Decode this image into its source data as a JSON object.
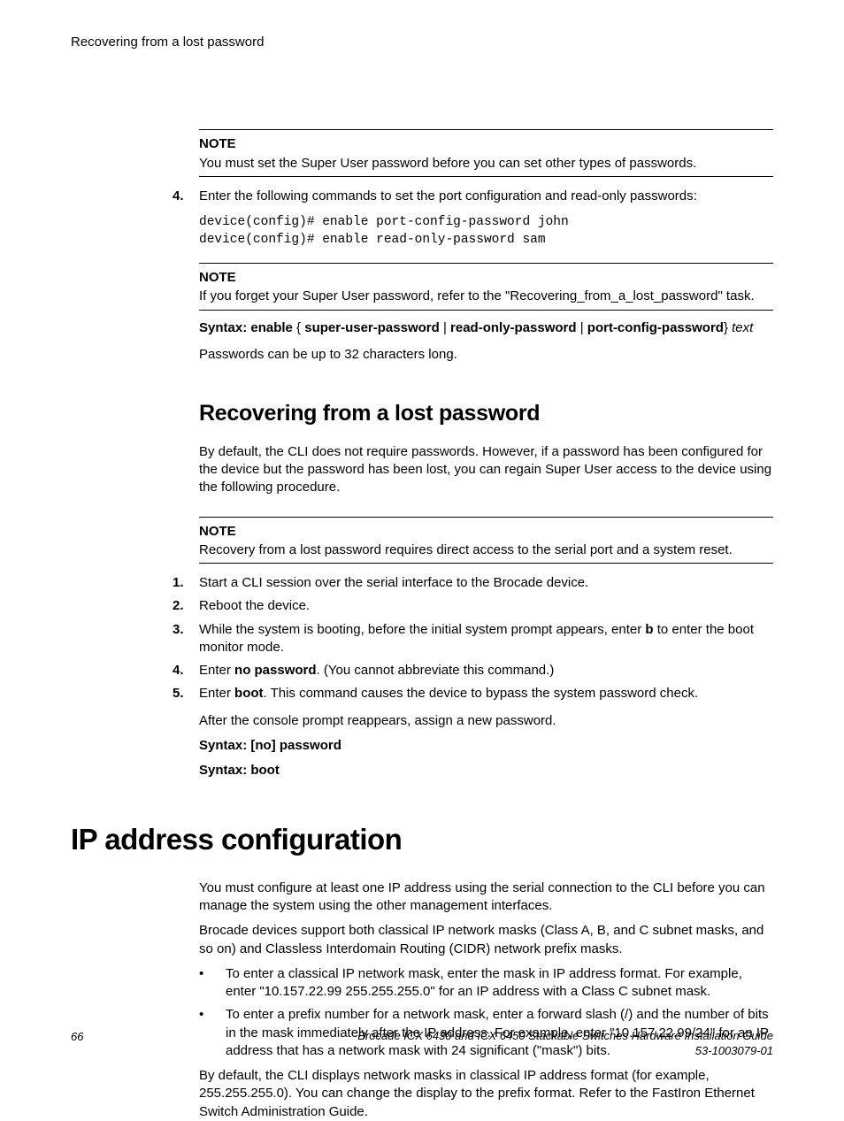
{
  "running_head": "Recovering from a lost password",
  "note1": {
    "label": "NOTE",
    "text": "You must set the Super User password before you can set other types of passwords."
  },
  "step4": {
    "num": "4.",
    "text": "Enter the following commands to set the port configuration and read-only passwords:"
  },
  "code_block": "device(config)# enable port-config-password john\ndevice(config)# enable read-only-password sam",
  "note2": {
    "label": "NOTE",
    "text": "If you forget your Super User password, refer to the \"Recovering_from_a_lost_password\" task."
  },
  "syntax_enable": {
    "prefix": "Syntax: enable",
    "brace_open": " { ",
    "opt1": "super-user-password",
    "sep": " | ",
    "opt2": "read-only-password",
    "opt3": "port-config-password",
    "brace_close": "} ",
    "tail_italic": "text"
  },
  "pw_len": "Passwords can be up to 32 characters long.",
  "h2_recover": "Recovering from a lost password",
  "recover_intro": "By default, the CLI does not require passwords. However, if a password has been configured for the device but the password has been lost, you can regain Super User access to the device using the following procedure.",
  "note3": {
    "label": "NOTE",
    "text": "Recovery from a lost password requires direct access to the serial port and a system reset."
  },
  "steps": [
    {
      "num": "1.",
      "text_before": "Start a CLI session over the serial interface to the Brocade device."
    },
    {
      "num": "2.",
      "text_before": "Reboot the device."
    },
    {
      "num": "3.",
      "text_before": "While the system is booting, before the initial system prompt appears, enter ",
      "bold": "b",
      "text_after": " to enter the boot monitor mode."
    },
    {
      "num": "4.",
      "text_before": "Enter ",
      "bold": "no password",
      "text_after": ". (You cannot abbreviate this command.)"
    },
    {
      "num": "5.",
      "text_before": "Enter ",
      "bold": "boot",
      "text_after": ". This command causes the device to bypass the system password check."
    }
  ],
  "after_steps": "After the console prompt reappears, assign a new password.",
  "syntax_no_pw": "Syntax: [no] password",
  "syntax_boot": "Syntax: boot",
  "h1_ip": "IP address configuration",
  "ip_p1": "You must configure at least one IP address using the serial connection to the CLI before you can manage the system using the other management interfaces.",
  "ip_p2": "Brocade devices support both classical IP network masks (Class A, B, and C subnet masks, and so on) and Classless Interdomain Routing (CIDR) network prefix masks.",
  "ip_bullets": [
    "To enter a classical IP network mask, enter the mask in IP address format. For example, enter \"10.157.22.99 255.255.255.0\" for an IP address with a Class C subnet mask.",
    "To enter a prefix number for a network mask, enter a forward slash (/) and the number of bits in the mask immediately after the IP address. For example, enter \"10.157.22.99/24\" for an IP address that has a network mask with 24 significant (\"mask\") bits."
  ],
  "ip_p3": "By default, the CLI displays network masks in classical IP address format (for example, 255.255.255.0). You can change the display to the prefix format. Refer to the FastIron Ethernet Switch Administration Guide.",
  "footer": {
    "page": "66",
    "title": "Brocade ICX 6430 and ICX 6450 Stackable Switches Hardware Installation Guide",
    "docnum": "53-1003079-01"
  }
}
